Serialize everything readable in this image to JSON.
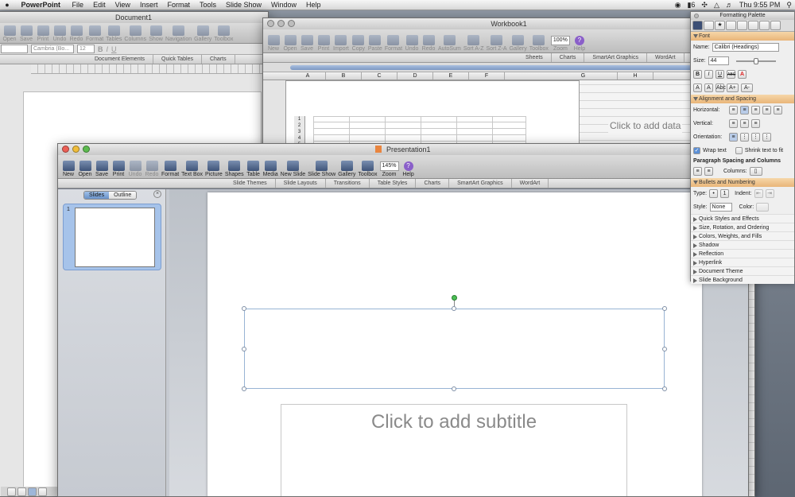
{
  "menubar": {
    "app_name": "PowerPoint",
    "items": [
      "File",
      "Edit",
      "View",
      "Insert",
      "Format",
      "Tools",
      "Slide Show",
      "Window",
      "Help"
    ],
    "status_icons": [
      "camera-icon",
      "script-icon"
    ],
    "battery_label": "6",
    "clock": "Thu 9:55 PM"
  },
  "word": {
    "title": "Document1",
    "toolbar": [
      "Open",
      "Save",
      "Print",
      "Undo",
      "Redo",
      "Format",
      "Tables",
      "Columns",
      "Show",
      "Navigation",
      "Gallery",
      "Toolbox"
    ],
    "font_name": "Cambria (Bo...",
    "font_size": "12",
    "ribbon_tabs": [
      "Document Elements",
      "Quick Tables",
      "Charts"
    ]
  },
  "excel": {
    "title": "Workbook1",
    "toolbar": [
      "New",
      "Open",
      "Save",
      "Print",
      "Import",
      "Copy",
      "Paste",
      "Format",
      "Undo",
      "Redo",
      "AutoSum",
      "Sort A-Z",
      "Sort Z-A",
      "Gallery",
      "Toolbox",
      "Zoom",
      "Help"
    ],
    "zoom_value": "100%",
    "ribbon_tabs": [
      "Sheets",
      "Charts",
      "SmartArt Graphics",
      "WordArt"
    ],
    "columns": [
      "A",
      "B",
      "C",
      "D",
      "E",
      "F",
      "G",
      "H"
    ],
    "rows": [
      "1",
      "2",
      "3",
      "4",
      "5"
    ],
    "placeholder": "Click to add data"
  },
  "ppt": {
    "title": "Presentation1",
    "toolbar": [
      "New",
      "Open",
      "Save",
      "Print",
      "Undo",
      "Redo",
      "Format",
      "Text Box",
      "Picture",
      "Shapes",
      "Table",
      "Media",
      "New Slide",
      "Slide Show",
      "Gallery",
      "Toolbox",
      "Zoom",
      "Help"
    ],
    "zoom_value": "145%",
    "ribbon_tabs": [
      "Slide Themes",
      "Slide Layouts",
      "Transitions",
      "Table Styles",
      "Charts",
      "SmartArt Graphics",
      "WordArt"
    ],
    "pane_tabs": {
      "slides": "Slides",
      "outline": "Outline"
    },
    "slide_number": "1",
    "subtitle_placeholder": "Click to add subtitle"
  },
  "palette": {
    "title": "Formatting Palette",
    "font_section": "Font",
    "name_label": "Name:",
    "font_name": "Calibri (Headings)",
    "size_label": "Size:",
    "font_size": "44",
    "style_buttons": [
      "B",
      "I",
      "U",
      "ABC",
      "A"
    ],
    "case_buttons": [
      "A",
      "A",
      "Abc",
      "A+",
      "A-"
    ],
    "align_section": "Alignment and Spacing",
    "horizontal_label": "Horizontal:",
    "vertical_label": "Vertical:",
    "orientation_label": "Orientation:",
    "wrap_label": "Wrap text",
    "wrap_checked": true,
    "shrink_label": "Shrink text to fit",
    "shrink_checked": false,
    "para_section": "Paragraph Spacing and Columns",
    "columns_label": "Columns:",
    "bullets_section": "Bullets and Numbering",
    "type_label": "Type:",
    "indent_label": "Indent:",
    "style_label": "Style:",
    "style_value": "None",
    "color_label": "Color:",
    "collapsed": [
      "Quick Styles and Effects",
      "Size, Rotation, and Ordering",
      "Colors, Weights, and Fills",
      "Shadow",
      "Reflection",
      "Hyperlink",
      "Document Theme",
      "Slide Background"
    ]
  }
}
